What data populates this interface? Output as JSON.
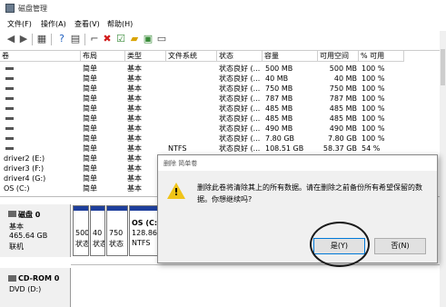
{
  "app": {
    "title": "磁盘管理"
  },
  "menu": [
    "文件(F)",
    "操作(A)",
    "查看(V)",
    "帮助(H)"
  ],
  "columns": [
    "卷",
    "布局",
    "类型",
    "文件系统",
    "状态",
    "容量",
    "可用空间",
    "% 可用"
  ],
  "rows": [
    {
      "vol": "",
      "layout": "简单",
      "type": "基本",
      "fs": "",
      "status": "状态良好 (...",
      "cap": "500 MB",
      "free": "500 MB",
      "pct": "100 %"
    },
    {
      "vol": "",
      "layout": "简单",
      "type": "基本",
      "fs": "",
      "status": "状态良好 (...",
      "cap": "40 MB",
      "free": "40 MB",
      "pct": "100 %"
    },
    {
      "vol": "",
      "layout": "简单",
      "type": "基本",
      "fs": "",
      "status": "状态良好 (...",
      "cap": "750 MB",
      "free": "750 MB",
      "pct": "100 %"
    },
    {
      "vol": "",
      "layout": "简单",
      "type": "基本",
      "fs": "",
      "status": "状态良好 (...",
      "cap": "787 MB",
      "free": "787 MB",
      "pct": "100 %"
    },
    {
      "vol": "",
      "layout": "简单",
      "type": "基本",
      "fs": "",
      "status": "状态良好 (...",
      "cap": "485 MB",
      "free": "485 MB",
      "pct": "100 %"
    },
    {
      "vol": "",
      "layout": "简单",
      "type": "基本",
      "fs": "",
      "status": "状态良好 (...",
      "cap": "485 MB",
      "free": "485 MB",
      "pct": "100 %"
    },
    {
      "vol": "",
      "layout": "简单",
      "type": "基本",
      "fs": "",
      "status": "状态良好 (...",
      "cap": "490 MB",
      "free": "490 MB",
      "pct": "100 %"
    },
    {
      "vol": "",
      "layout": "简单",
      "type": "基本",
      "fs": "",
      "status": "状态良好 (...",
      "cap": "7.80 GB",
      "free": "7.80 GB",
      "pct": "100 %"
    },
    {
      "vol": "",
      "layout": "简单",
      "type": "基本",
      "fs": "NTFS",
      "status": "状态良好 (...",
      "cap": "108.51 GB",
      "free": "58.37 GB",
      "pct": "54 %"
    },
    {
      "vol": "driver2 (E:)",
      "layout": "简单",
      "type": "基本",
      "fs": "",
      "status": "",
      "cap": "",
      "free": "",
      "pct": ""
    },
    {
      "vol": "driver3 (F:)",
      "layout": "简单",
      "type": "基本",
      "fs": "",
      "status": "",
      "cap": "",
      "free": "",
      "pct": ""
    },
    {
      "vol": "driver4 (G:)",
      "layout": "简单",
      "type": "基本",
      "fs": "",
      "status": "",
      "cap": "",
      "free": "",
      "pct": ""
    },
    {
      "vol": "OS (C:)",
      "layout": "简单",
      "type": "基本",
      "fs": "",
      "status": "",
      "cap": "",
      "free": "",
      "pct": ""
    }
  ],
  "disk0": {
    "name": "磁盘 0",
    "type": "基本",
    "size": "465.64 GB",
    "state": "联机"
  },
  "partitions": [
    {
      "line1": "",
      "line2": "500",
      "line3": "状态"
    },
    {
      "line1": "",
      "line2": "40",
      "line3": "状态"
    },
    {
      "line1": "",
      "line2": "750",
      "line3": "状态"
    },
    {
      "line1": "OS (C:",
      "line2": "128.86",
      "line3": "NTFS"
    }
  ],
  "cdrom": {
    "name": "CD-ROM 0",
    "drive": "DVD (D:)"
  },
  "dialog": {
    "title": "删除 简单卷",
    "message": "删除此卷将清除其上的所有数据。请在删除之前备份所有希望保留的数据。你想继续吗?",
    "yes": "是(Y)",
    "no": "否(N)"
  },
  "colors": {
    "partition_header": "#1e3f9c",
    "warning": "#f0c419"
  }
}
